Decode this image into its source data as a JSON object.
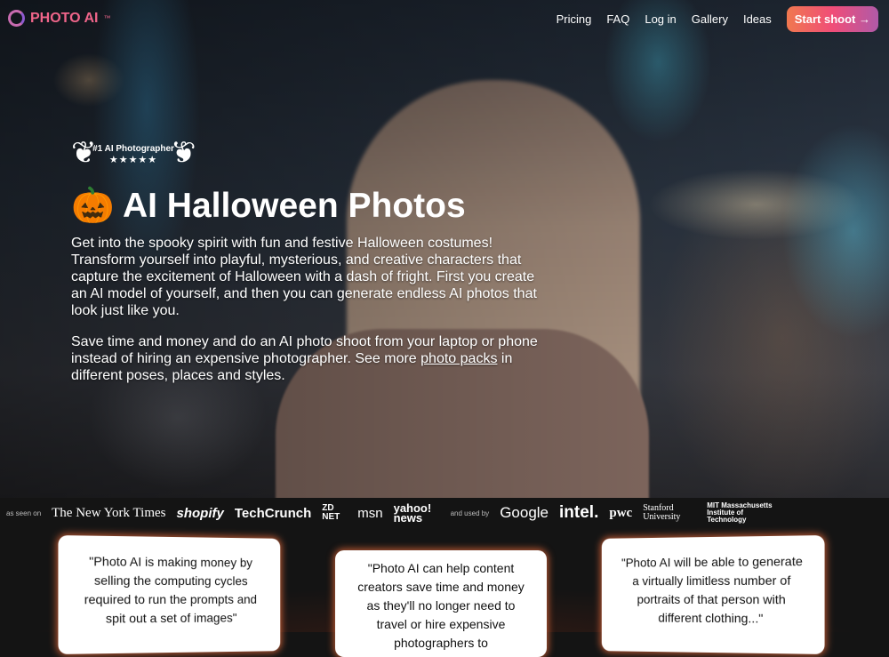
{
  "nav": {
    "brand": "PHOTO AI",
    "tm": "™",
    "links": [
      "Pricing",
      "FAQ",
      "Log in",
      "Gallery",
      "Ideas"
    ],
    "cta": "Start shoot →"
  },
  "hero": {
    "badge_title": "#1 AI Photographer",
    "badge_stars": "★★★★★",
    "title": "🎃 AI Halloween Photos",
    "p1": "Get into the spooky spirit with fun and festive Halloween costumes! Transform yourself into playful, mysterious, and creative characters that capture the excitement of Halloween with a dash of fright. First you create an AI model of yourself, and then you can generate endless AI photos that look just like you.",
    "p2_before": "Save time and money and do an AI photo shoot from your laptop or phone instead of hiring an expensive photographer. See more ",
    "p2_link": "photo packs",
    "p2_after": " in different poses, places and styles."
  },
  "press": {
    "seen_label": "as seen on",
    "seen": [
      "The New York Times",
      "shopify",
      "TechCrunch",
      "ZD NET",
      "msn",
      "yahoo! news"
    ],
    "used_label": "and used by",
    "used": [
      "Google",
      "intel.",
      "pwc",
      "Stanford University",
      "MIT Massachusetts Institute of Technology"
    ]
  },
  "quotes": [
    "\"Photo AI is making money by selling the computing cycles required to run the prompts and spit out a set of images\"",
    "\"Photo AI can help content creators save time and money as they'll no longer need to travel or hire expensive photographers to",
    "\"Photo AI will be able to generate a virtually limitless number of portraits of that person with different clothing...\""
  ]
}
